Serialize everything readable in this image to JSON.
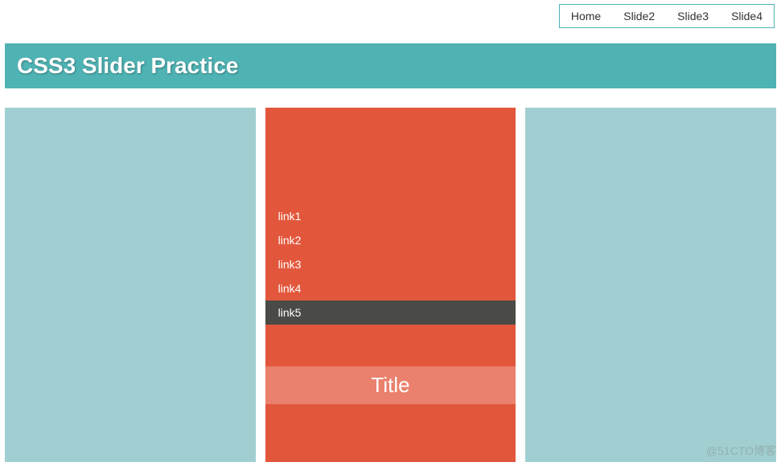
{
  "nav": {
    "items": [
      {
        "label": "Home"
      },
      {
        "label": "Slide2"
      },
      {
        "label": "Slide3"
      },
      {
        "label": "Slide4"
      }
    ]
  },
  "header": {
    "title": "CSS3 Slider Practice"
  },
  "active_slide": {
    "links": [
      {
        "label": "link1",
        "highlighted": false
      },
      {
        "label": "link2",
        "highlighted": false
      },
      {
        "label": "link3",
        "highlighted": false
      },
      {
        "label": "link4",
        "highlighted": false
      },
      {
        "label": "link5",
        "highlighted": true
      }
    ],
    "title": "Title"
  },
  "watermark": "@51CTO博客"
}
